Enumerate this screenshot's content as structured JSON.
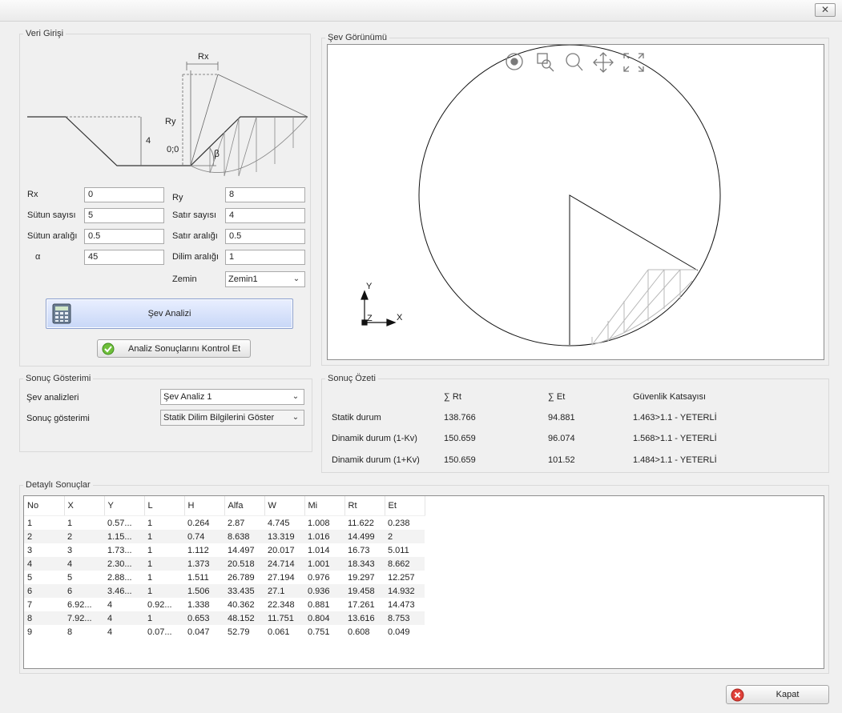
{
  "window": {
    "close_glyph": "✕"
  },
  "input_group": {
    "title": "Veri Girişi",
    "diagram": {
      "rx": "Rx",
      "ry": "Ry",
      "depth": "4",
      "origin": "0;0",
      "beta": "β"
    },
    "fields": {
      "rx": {
        "label": "Rx",
        "value": "0"
      },
      "ry": {
        "label": "Ry",
        "value": "8"
      },
      "cols": {
        "label": "Sütun sayısı",
        "value": "5"
      },
      "rows": {
        "label": "Satır sayısı",
        "value": "4"
      },
      "col_spacing": {
        "label": "Sütun aralığı",
        "value": "0.5"
      },
      "row_spacing": {
        "label": "Satır aralığı",
        "value": "0.5"
      },
      "alpha": {
        "label": "α",
        "value": "45"
      },
      "slice_spacing": {
        "label": "Dilim aralığı",
        "value": "1"
      },
      "soil": {
        "label": "Zemin",
        "value": "Zemin1"
      }
    },
    "analyze_button": "Şev Analizi",
    "check_button": "Analiz Sonuçlarını Kontrol Et"
  },
  "view_group": {
    "title": "Şev Görünümü",
    "axes": {
      "y": "Y",
      "x": "X",
      "z": "Z"
    }
  },
  "result_display": {
    "title": "Sonuç Gösterimi",
    "analyses_label": "Şev analizleri",
    "analyses_value": "Şev Analiz 1",
    "display_label": "Sonuç gösterimi",
    "display_value": "Statik Dilim Bilgilerini Göster"
  },
  "summary": {
    "title": "Sonuç Özeti",
    "headers": [
      "∑ Rt",
      "∑ Et",
      "Güvenlik Katsayısı"
    ],
    "rows": [
      {
        "label": "Statik durum",
        "rt": "138.766",
        "et": "94.881",
        "fs": "1.463>1.1 - YETERLİ"
      },
      {
        "label": "Dinamik durum (1-Kv)",
        "rt": "150.659",
        "et": "96.074",
        "fs": "1.568>1.1 - YETERLİ"
      },
      {
        "label": "Dinamik durum (1+Kv)",
        "rt": "150.659",
        "et": "101.52",
        "fs": "1.484>1.1 - YETERLİ"
      }
    ]
  },
  "details": {
    "title": "Detaylı Sonuçlar",
    "columns": [
      "No",
      "X",
      "Y",
      "L",
      "H",
      "Alfa",
      "W",
      "Mi",
      "Rt",
      "Et"
    ],
    "rows": [
      [
        "1",
        "1",
        "0.57...",
        "1",
        "0.264",
        "2.87",
        "4.745",
        "1.008",
        "11.622",
        "0.238"
      ],
      [
        "2",
        "2",
        "1.15...",
        "1",
        "0.74",
        "8.638",
        "13.319",
        "1.016",
        "14.499",
        "2"
      ],
      [
        "3",
        "3",
        "1.73...",
        "1",
        "1.112",
        "14.497",
        "20.017",
        "1.014",
        "16.73",
        "5.011"
      ],
      [
        "4",
        "4",
        "2.30...",
        "1",
        "1.373",
        "20.518",
        "24.714",
        "1.001",
        "18.343",
        "8.662"
      ],
      [
        "5",
        "5",
        "2.88...",
        "1",
        "1.511",
        "26.789",
        "27.194",
        "0.976",
        "19.297",
        "12.257"
      ],
      [
        "6",
        "6",
        "3.46...",
        "1",
        "1.506",
        "33.435",
        "27.1",
        "0.936",
        "19.458",
        "14.932"
      ],
      [
        "7",
        "6.92...",
        "4",
        "0.92...",
        "1.338",
        "40.362",
        "22.348",
        "0.881",
        "17.261",
        "14.473"
      ],
      [
        "8",
        "7.92...",
        "4",
        "1",
        "0.653",
        "48.152",
        "11.751",
        "0.804",
        "13.616",
        "8.753"
      ],
      [
        "9",
        "8",
        "4",
        "0.07...",
        "0.047",
        "52.79",
        "0.061",
        "0.751",
        "0.608",
        "0.049"
      ]
    ]
  },
  "close_button": "Kapat"
}
